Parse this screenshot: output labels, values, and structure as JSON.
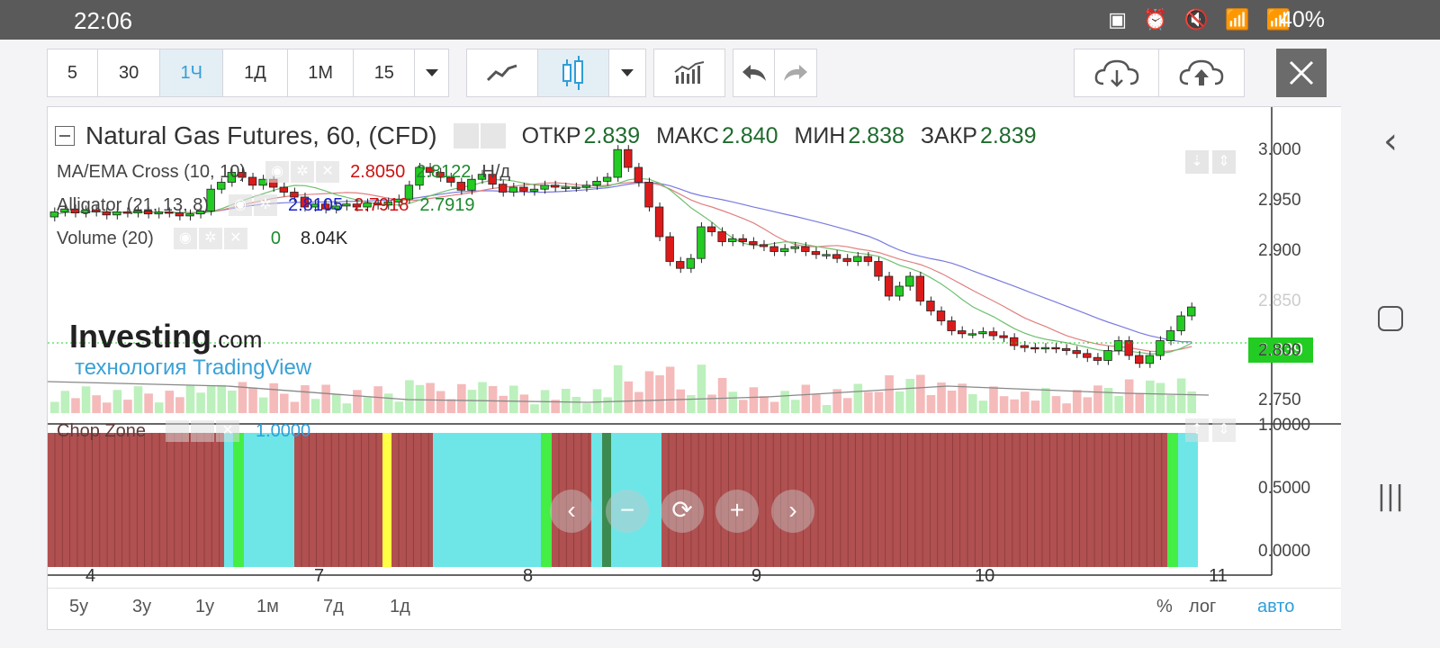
{
  "status_bar": {
    "time": "22:06",
    "icons": "▣ ⏰ 🔇 📶 📶",
    "battery": "40%"
  },
  "toolbar": {
    "intervals": [
      "5",
      "30",
      "1Ч",
      "1Д",
      "1М",
      "15"
    ],
    "active_interval": "1Ч",
    "icons": [
      "line-chart-icon",
      "candlestick-icon",
      "chevron-down-icon",
      "indicators-icon",
      "undo-icon",
      "redo-icon",
      "cloud-download-icon",
      "cloud-upload-icon",
      "close-icon"
    ]
  },
  "chart": {
    "title": "Natural Gas Futures, 60, (CFD)",
    "ohlc": [
      {
        "k": "ОТКР",
        "v": "2.839"
      },
      {
        "k": "МАКС",
        "v": "2.840"
      },
      {
        "k": "МИН",
        "v": "2.838"
      },
      {
        "k": "ЗАКР",
        "v": "2.839"
      }
    ],
    "indicators": {
      "ma": {
        "label": "MA/EMA Cross (10, 10)",
        "v1": "2.8050",
        "v2": "2.8122",
        "tag": "Н/д"
      },
      "alligator": {
        "label": "Alligator (21, 13, 8)",
        "v1": "2.8105",
        "v2": "2.7918",
        "v3": "2.7919"
      },
      "volume": {
        "label": "Volume (20)",
        "v1": "0",
        "v2": "8.04K"
      }
    },
    "price_tag": "2.839",
    "y_ticks": [
      "3.000",
      "2.950",
      "2.900",
      "2.850",
      "2.800",
      "2.750"
    ],
    "x_ticks": [
      "4",
      "7",
      "8",
      "9",
      "10",
      "11"
    ],
    "chop": {
      "label": "Chop Zone",
      "value": "1.0000",
      "y_ticks": [
        "1.0000",
        "0.5000",
        "0.0000"
      ]
    },
    "branding": {
      "logo": "Investing",
      "logo_suffix": ".com",
      "credit": "технология TradingView"
    },
    "ranges": [
      "5y",
      "3y",
      "1y",
      "1м",
      "7д",
      "1д"
    ],
    "scale": [
      "%",
      "лог",
      "авто"
    ],
    "colors": {
      "up": "#22cc22",
      "down": "#dd1a1a",
      "chop_red": "#b05050",
      "chop_cyan": "#6ee6e8",
      "chop_green": "#44ee44",
      "chop_yellow": "#ffff44"
    }
  }
}
